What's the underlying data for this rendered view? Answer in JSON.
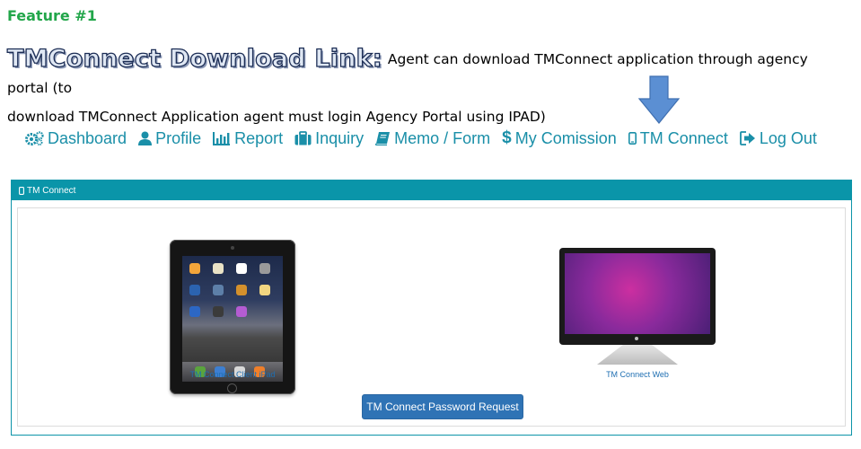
{
  "feature_label": "Feature #1",
  "heading": {
    "title": "TMConnect Download Link:",
    "description_line1": "Agent can download TMConnect application through agency portal (to",
    "description_line2": "download TMConnect Application agent must login Agency Portal using IPAD)"
  },
  "nav": {
    "items": [
      {
        "label": "Dashboard",
        "icon": "cogs-icon"
      },
      {
        "label": "Profile",
        "icon": "user-icon"
      },
      {
        "label": "Report",
        "icon": "bar-chart-icon"
      },
      {
        "label": "Inquiry",
        "icon": "briefcase-icon"
      },
      {
        "label": "Memo / Form",
        "icon": "book-icon"
      },
      {
        "label": "My Comission",
        "icon": "dollar-icon"
      },
      {
        "label": "TM Connect",
        "icon": "mobile-icon"
      },
      {
        "label": "Log Out",
        "icon": "sign-out-icon"
      }
    ]
  },
  "panel": {
    "title": "TM Connect",
    "ipad_caption": "TM Connect Client iPad",
    "web_caption": "TM Connect Web",
    "password_button": "TM Connect Password Request"
  },
  "colors": {
    "feature_green": "#22a64a",
    "nav_teal": "#1a8fa8",
    "panel_header": "#0a95a9",
    "button_blue": "#2f73b5",
    "arrow_blue": "#5b8fd3"
  }
}
